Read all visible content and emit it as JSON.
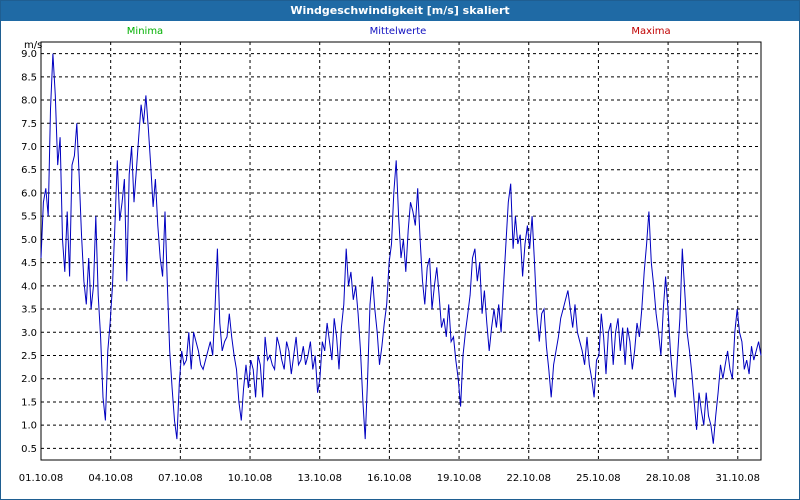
{
  "window": {
    "title": "Windgeschwindigkeit [m/s] skaliert"
  },
  "colors": {
    "titlebar": "#1f6aa5",
    "min": "#00b000",
    "mean": "#1010c0",
    "max": "#c00000",
    "line": "#0000c0"
  },
  "chart_data": {
    "type": "line",
    "title": "Windgeschwindigkeit [m/s] skaliert",
    "ylabel": "m/s",
    "ylim": [
      0.25,
      9.25
    ],
    "yticks": [
      "9.0",
      "8.5",
      "8.0",
      "7.5",
      "7.0",
      "6.5",
      "6.0",
      "5.5",
      "5.0",
      "4.5",
      "4.0",
      "3.5",
      "3.0",
      "2.5",
      "2.0",
      "1.5",
      "1.0",
      "0.5"
    ],
    "xticks": [
      "01.10.08",
      "04.10.08",
      "07.10.08",
      "10.10.08",
      "13.10.08",
      "16.10.08",
      "19.10.08",
      "22.10.08",
      "25.10.08",
      "28.10.08",
      "31.10.08"
    ],
    "legend": {
      "min": "Minima",
      "mean": "Mittelwerte",
      "max": "Maxima"
    },
    "grid": true,
    "series": [
      {
        "values": [
          4.6,
          5.8,
          6.1,
          5.5,
          7.8,
          9.0,
          8.1,
          6.6,
          7.2,
          5.0,
          4.3,
          5.6,
          4.2,
          6.6,
          6.8,
          7.5,
          6.4,
          5.1,
          4.1,
          3.6,
          4.6,
          3.5,
          4.0,
          5.5,
          3.8,
          2.9,
          1.6,
          1.1,
          2.6,
          3.2,
          4.0,
          5.3,
          6.7,
          5.4,
          5.8,
          6.3,
          4.1,
          6.4,
          7.0,
          5.8,
          6.5,
          7.2,
          7.9,
          7.5,
          8.1,
          7.4,
          6.6,
          5.7,
          6.3,
          5.3,
          4.6,
          4.2,
          5.6,
          4.0,
          2.6,
          1.8,
          1.1,
          0.7,
          1.9,
          2.6,
          2.3,
          2.4,
          3.0,
          2.2,
          3.0,
          2.8,
          2.6,
          2.3,
          2.2,
          2.4,
          2.6,
          2.8,
          2.5,
          3.5,
          4.8,
          3.2,
          2.6,
          2.8,
          2.9,
          3.4,
          2.9,
          2.5,
          2.2,
          1.5,
          1.1,
          1.8,
          2.3,
          1.8,
          2.4,
          2.2,
          1.6,
          2.5,
          2.3,
          1.6,
          2.9,
          2.4,
          2.5,
          2.3,
          2.2,
          2.9,
          2.7,
          2.4,
          2.2,
          2.8,
          2.6,
          2.1,
          2.5,
          2.9,
          2.3,
          2.4,
          2.7,
          2.3,
          2.5,
          2.8,
          2.2,
          2.5,
          1.7,
          2.0,
          2.8,
          2.6,
          3.2,
          2.8,
          2.4,
          3.3,
          2.9,
          2.2,
          3.1,
          3.6,
          4.8,
          4.0,
          4.3,
          3.7,
          4.0,
          3.4,
          2.6,
          1.5,
          0.7,
          2.0,
          3.6,
          4.2,
          3.5,
          3.0,
          2.3,
          2.7,
          3.2,
          3.6,
          4.5,
          4.9,
          6.0,
          6.7,
          5.5,
          4.6,
          5.0,
          4.3,
          5.2,
          5.8,
          5.6,
          5.3,
          6.1,
          5.0,
          4.1,
          3.6,
          4.4,
          4.6,
          3.5,
          4.0,
          4.4,
          3.8,
          3.1,
          3.3,
          2.9,
          3.6,
          2.8,
          2.9,
          2.4,
          2.0,
          1.4,
          2.5,
          3.0,
          3.4,
          3.8,
          4.6,
          4.8,
          4.1,
          4.5,
          3.4,
          3.9,
          3.2,
          2.6,
          3.1,
          3.5,
          3.1,
          3.6,
          3.0,
          4.0,
          4.9,
          5.8,
          6.2,
          4.8,
          5.5,
          4.9,
          5.1,
          4.2,
          4.9,
          5.3,
          4.8,
          5.5,
          4.5,
          3.4,
          2.8,
          3.4,
          3.5,
          2.7,
          2.2,
          1.6,
          2.3,
          2.6,
          2.9,
          3.3,
          3.5,
          3.7,
          3.9,
          3.5,
          3.1,
          3.6,
          3.0,
          2.8,
          2.6,
          2.3,
          2.9,
          2.3,
          2.0,
          1.6,
          2.4,
          2.5,
          3.4,
          2.9,
          2.1,
          3.0,
          3.2,
          2.3,
          3.0,
          3.3,
          2.6,
          3.1,
          2.3,
          3.1,
          2.8,
          2.2,
          2.6,
          3.2,
          2.9,
          3.5,
          4.3,
          4.9,
          5.6,
          4.5,
          4.0,
          3.4,
          3.0,
          2.5,
          3.5,
          4.2,
          3.5,
          2.6,
          2.0,
          1.6,
          2.5,
          3.3,
          4.8,
          3.9,
          3.0,
          2.6,
          2.1,
          1.5,
          0.9,
          1.7,
          1.3,
          1.0,
          1.7,
          1.2,
          1.0,
          0.6,
          1.2,
          1.7,
          2.3,
          2.0,
          2.3,
          2.6,
          2.2,
          2.0,
          3.0,
          3.5,
          3.0,
          2.8,
          2.2,
          2.4,
          2.1,
          2.7,
          2.4,
          2.6,
          2.8,
          2.5
        ]
      }
    ]
  }
}
